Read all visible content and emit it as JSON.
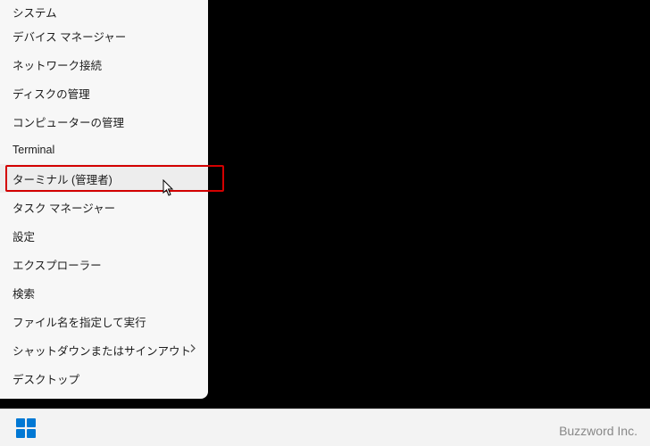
{
  "menu": {
    "items": [
      {
        "label": "システム",
        "submenu": false
      },
      {
        "label": "デバイス マネージャー",
        "submenu": false
      },
      {
        "label": "ネットワーク接続",
        "submenu": false
      },
      {
        "label": "ディスクの管理",
        "submenu": false
      },
      {
        "label": "コンピューターの管理",
        "submenu": false
      },
      {
        "label": "Terminal",
        "submenu": false
      },
      {
        "label": "ターミナル (管理者)",
        "submenu": false,
        "highlighted": true,
        "hovered": true
      },
      {
        "label": "タスク マネージャー",
        "submenu": false
      },
      {
        "label": "設定",
        "submenu": false
      },
      {
        "label": "エクスプローラー",
        "submenu": false
      },
      {
        "label": "検索",
        "submenu": false
      },
      {
        "label": "ファイル名を指定して実行",
        "submenu": false
      },
      {
        "label": "シャットダウンまたはサインアウト",
        "submenu": true
      },
      {
        "label": "デスクトップ",
        "submenu": false
      }
    ]
  },
  "watermark": "Buzzword Inc."
}
